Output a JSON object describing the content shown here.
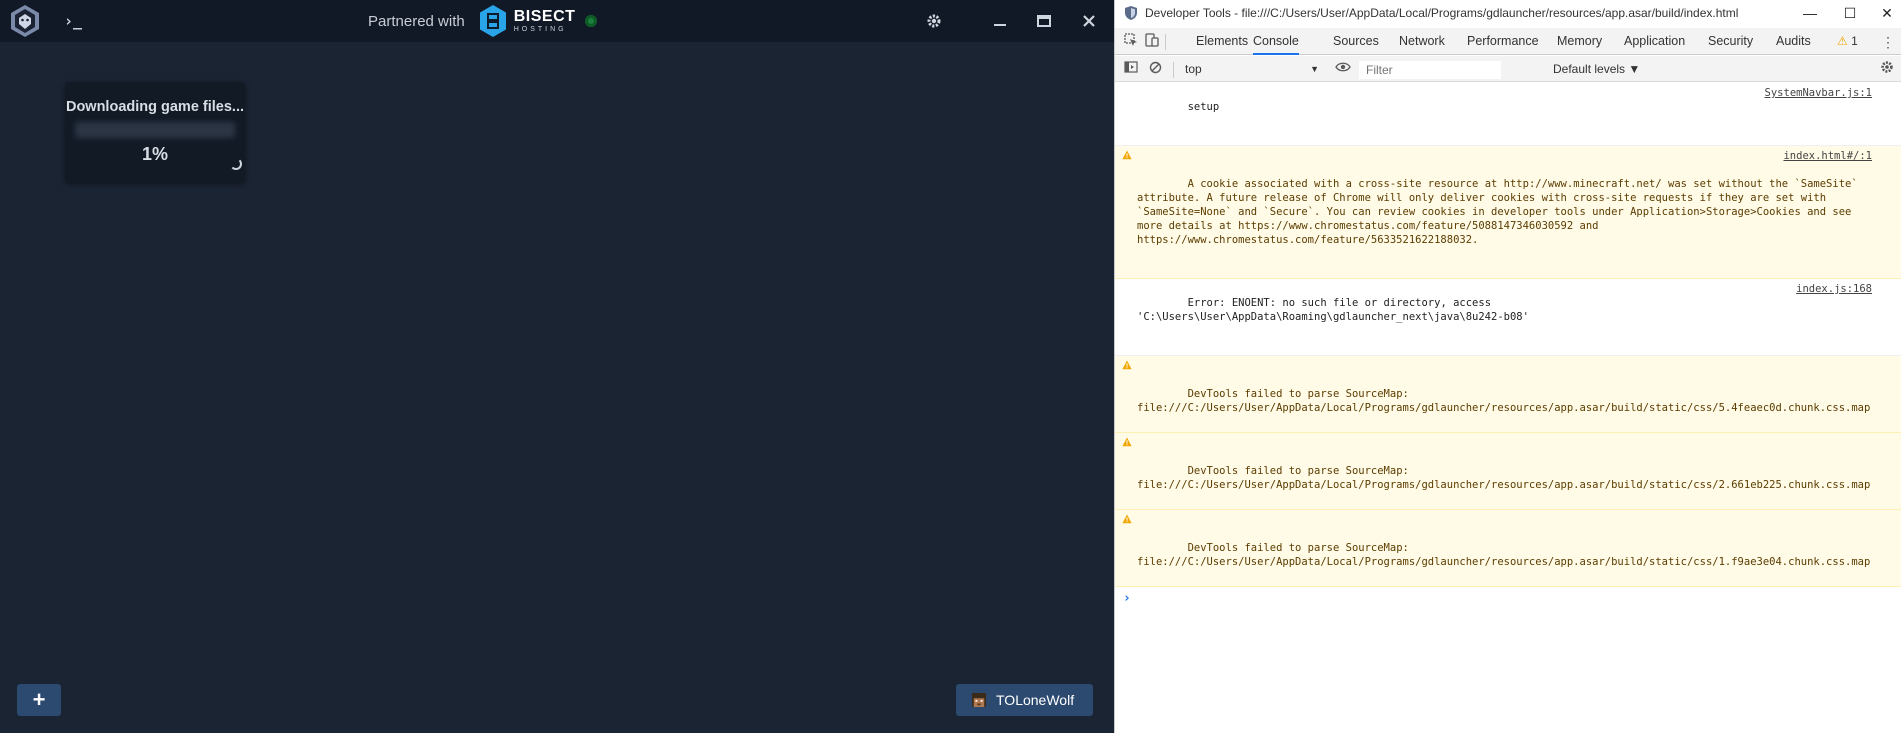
{
  "launcher": {
    "partner_text": "Partnered with",
    "partner_brand": "BISECT",
    "partner_brand_sub": "HOSTING",
    "instance": {
      "status": "Downloading game files...",
      "progress_text": "1%",
      "progress": 0.01
    },
    "add_label": "+",
    "account_name": "TOLoneWolf"
  },
  "devtools": {
    "title": "Developer Tools - file:///C:/Users/User/AppData/Local/Programs/gdlauncher/resources/app.asar/build/index.html",
    "tabs": [
      "Elements",
      "Console",
      "Sources",
      "Network",
      "Performance",
      "Memory",
      "Application",
      "Security",
      "Audits"
    ],
    "active_tab": "Console",
    "warnings_count": "1",
    "context": "top",
    "filter_placeholder": "Filter",
    "levels": "Default levels ▼",
    "messages": [
      {
        "type": "log",
        "text": "setup",
        "source": "SystemNavbar.js:1"
      },
      {
        "type": "warn",
        "text": "A cookie associated with a cross-site resource at http://www.minecraft.net/ was set without the `SameSite` attribute. A future release of Chrome will only deliver cookies with cross-site requests if they are set with `SameSite=None` and `Secure`. You can review cookies in developer tools under Application>Storage>Cookies and see more details at https://www.chromestatus.com/feature/5088147346030592 and https://www.chromestatus.com/feature/5633521622188032.",
        "source": "index.html#/:1"
      },
      {
        "type": "log",
        "text": "Error: ENOENT: no such file or directory, access\n'C:\\Users\\User\\AppData\\Roaming\\gdlauncher_next\\java\\8u242-b08'",
        "source": "index.js:168"
      },
      {
        "type": "warn",
        "text": "DevTools failed to parse SourceMap: file:///C:/Users/User/AppData/Local/Programs/gdlauncher/resources/app.asar/build/static/css/5.4feaec0d.chunk.css.map",
        "source": ""
      },
      {
        "type": "warn",
        "text": "DevTools failed to parse SourceMap: file:///C:/Users/User/AppData/Local/Programs/gdlauncher/resources/app.asar/build/static/css/2.661eb225.chunk.css.map",
        "source": ""
      },
      {
        "type": "warn",
        "text": "DevTools failed to parse SourceMap: file:///C:/Users/User/AppData/Local/Programs/gdlauncher/resources/app.asar/build/static/css/1.f9ae3e04.chunk.css.map",
        "source": ""
      }
    ],
    "prompt": "›"
  },
  "colors": {
    "launcher_bg": "#1b2433",
    "launcher_nav": "#111826",
    "button_blue": "#2c4a70",
    "accent_tab": "#1a73e8",
    "online": "#1a7f3a",
    "warn_bg": "#fffbe6"
  },
  "icons": [
    "gdlauncher-logo-icon",
    "terminal-icon",
    "bisect-logo-icon",
    "settings-gear-icon",
    "minimize-icon",
    "maximize-icon",
    "close-icon",
    "spinner-icon",
    "avatar-icon",
    "inspect-icon",
    "device-icon",
    "sidebar-icon",
    "clear-icon",
    "eye-icon",
    "warning-icon",
    "kebab-icon"
  ]
}
